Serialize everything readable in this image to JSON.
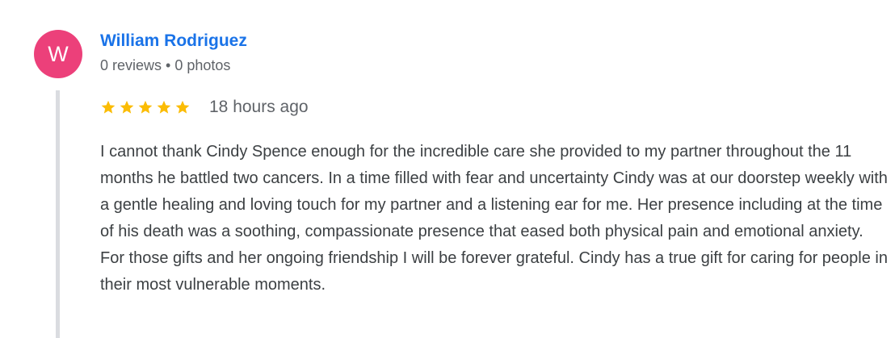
{
  "reviewer": {
    "avatar_letter": "W",
    "avatar_color": "#ec407a",
    "name": "William Rodriguez",
    "meta": "0 reviews • 0 photos"
  },
  "review": {
    "rating": 5,
    "rating_max": 5,
    "star_color": "#fbbc04",
    "star_icon": "star-icon",
    "time_ago": "18 hours ago",
    "text": "I cannot thank Cindy Spence enough for the incredible care she provided to my partner throughout the 11 months he battled two cancers. In a time filled with fear and uncertainty Cindy was at our doorstep weekly with a gentle healing and loving touch for my partner and a listening ear for me. Her presence including at the time of his death was a soothing, compassionate presence that eased both physical pain and emotional anxiety. For those gifts and her ongoing friendship I will be forever grateful. Cindy has a true gift for caring for people in their most vulnerable moments."
  },
  "colors": {
    "name_link": "#1a73e8",
    "meta_text": "#5f6368",
    "body_text": "#3c4043",
    "thread_line": "#dadce0"
  }
}
